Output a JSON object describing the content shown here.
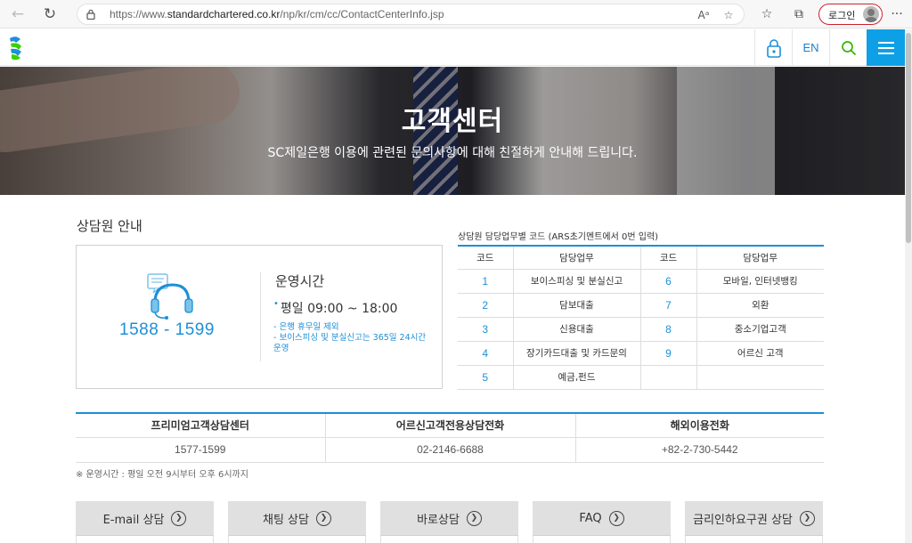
{
  "browser": {
    "url_prefix": "https://www.",
    "url_domain": "standardchartered.co.kr",
    "url_path": "/np/kr/cm/cc/ContactCenterInfo.jsp",
    "login_label": "로그인"
  },
  "header": {
    "lang_label": "EN",
    "colors": {
      "accent": "#0ea0e6",
      "brand_blue": "#1d8fd8",
      "brand_green": "#38d200"
    }
  },
  "hero": {
    "title": "고객센터",
    "subtitle": "SC제일은행 이용에 관련된 문의사항에 대해 친절하게 안내해 드립니다."
  },
  "counsel": {
    "section_title": "상담원 안내",
    "main_phone": "1588 - 1599",
    "hours_title": "운영시간",
    "hours_main": "평일  09:00 ~ 18:00",
    "notes": [
      "- 은행 휴무일 제외",
      "- 보이스피싱 및 분실신고는 365일 24시간 운영"
    ]
  },
  "code_table": {
    "caption": "상담원 담당업무별 코드 (ARS초기멘트에서 0번 입력)",
    "headers": [
      "코드",
      "담당업무",
      "코드",
      "담당업무"
    ],
    "rows": [
      [
        "1",
        "보이스피싱 및 분실신고",
        "6",
        "모바일, 인터넷뱅킹"
      ],
      [
        "2",
        "담보대출",
        "7",
        "외환"
      ],
      [
        "3",
        "신용대출",
        "8",
        "중소기업고객"
      ],
      [
        "4",
        "장기카드대출 및 카드문의",
        "9",
        "어르신 고객"
      ],
      [
        "5",
        "예금,펀드",
        "",
        ""
      ]
    ]
  },
  "phone_table": {
    "headers": [
      "프리미엄고객상담센터",
      "어르신고객전용상담전화",
      "해외이용전화"
    ],
    "values": [
      "1577-1599",
      "02-2146-6688",
      "+82-2-730-5442"
    ],
    "footnote": "※ 운영시간 : 평일 오전 9시부터 오후 6시까지"
  },
  "tabs": [
    {
      "label": "E-mail 상담"
    },
    {
      "label": "채팅 상담"
    },
    {
      "label": "바로상담"
    },
    {
      "label": "FAQ"
    },
    {
      "label": "금리인하요구권 상담"
    }
  ]
}
